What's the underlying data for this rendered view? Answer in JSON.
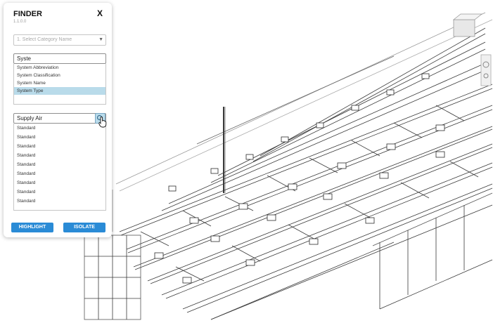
{
  "finder": {
    "title": "FINDER",
    "version": "1.1.0.0",
    "close_label": "X",
    "category_select": {
      "placeholder": "1. Select Category Name"
    },
    "parameter_search": {
      "value": "Syste"
    },
    "parameter_options": [
      "System Abbreviation",
      "System Classification",
      "System Name",
      "System Type"
    ],
    "selected_parameter": "System Type",
    "value_search": {
      "value": "Supply Air"
    },
    "value_results": [
      "Standard",
      "Standard",
      "Standard",
      "Standard",
      "Standard",
      "Standard",
      "Standard",
      "Standard",
      "Standard"
    ],
    "highlight_label": "HIGHLIGHT",
    "isolate_label": "ISOLATE"
  },
  "colors": {
    "accent": "#2a8bd6",
    "selection": "#b9dbea",
    "drawing": "#2b2b2b"
  },
  "icons": {
    "search": "search-icon",
    "cursor": "hand-pointer-icon",
    "viewcube": "viewcube-icon",
    "nav": "navigation-bar-icon"
  }
}
